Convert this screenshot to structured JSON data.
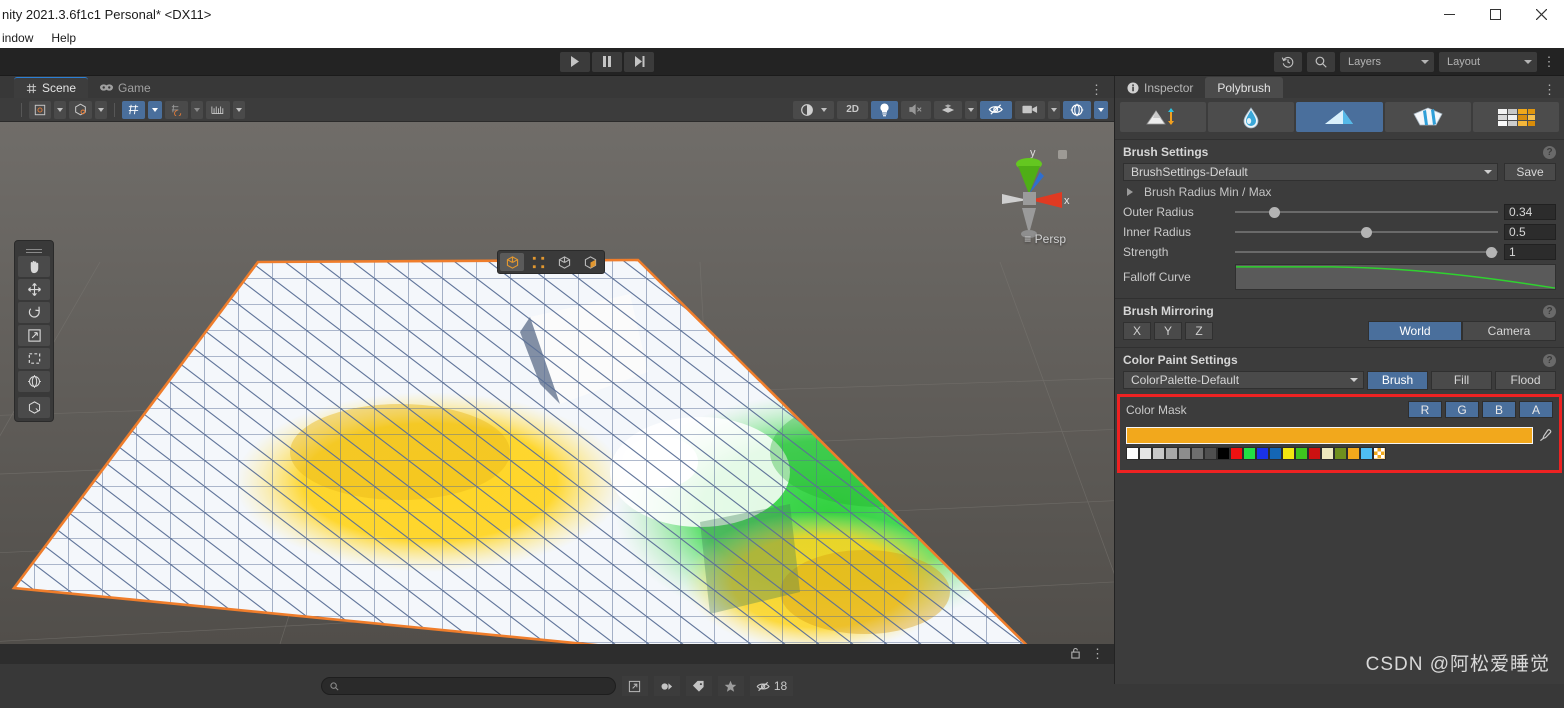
{
  "window": {
    "title": "nity 2021.3.6f1c1 Personal* <DX11>",
    "menu": [
      "indow",
      "Help"
    ],
    "controls": {
      "minimize": "—",
      "maximize": "▢",
      "close": "✕"
    }
  },
  "toolbar": {
    "play": "play-icon",
    "pause": "pause-icon",
    "step": "step-icon",
    "history_icon": "undo-history-icon",
    "search_icon": "search-icon",
    "layers": "Layers",
    "layout": "Layout"
  },
  "scene_panel": {
    "tabs": [
      {
        "label": "Scene",
        "icon": "grid-icon",
        "active": true
      },
      {
        "label": "Game",
        "icon": "gamepad-icon",
        "active": false
      }
    ],
    "overflow_menu": "⋮",
    "toolbar": {
      "pivot_mode": "pivot-icon",
      "orientation_mode": "global-local-icon",
      "grid_snap": "grid-snap-icon",
      "grid_snap_active": true,
      "surface_snap": "surface-snap-icon",
      "increment_snap": "increment-snap-icon",
      "shading_mode": "shading-mode-icon",
      "two_d": "2D",
      "lighting": "lighting-icon",
      "audio": "audio-mute-icon",
      "effects": "effects-icon",
      "hidden_objects": "hidden-objects-icon",
      "camera": "camera-icon",
      "gizmos": "gizmos-icon"
    },
    "tools_overlay": [
      "hand-tool-icon",
      "move-tool-icon",
      "rotate-tool-icon",
      "scale-tool-icon",
      "rect-tool-icon",
      "transform-tool-icon",
      "custom-editor-tool-icon"
    ],
    "element_modes": [
      {
        "name": "object-mode-icon",
        "active": true
      },
      {
        "name": "vertex-mode-icon",
        "active": false
      },
      {
        "name": "edge-mode-icon",
        "active": false
      },
      {
        "name": "face-mode-icon",
        "active": false
      }
    ],
    "gizmo": {
      "axis_x": "x",
      "axis_y": "y",
      "projection": "Persp",
      "persp_prefix": "≡"
    },
    "footer": {
      "lock_icon": "lock-icon",
      "menu_icon": "kebab-menu-icon"
    },
    "search": {
      "placeholder": "",
      "value": "",
      "icon": "search-icon",
      "popout_icon": "popout-icon",
      "filter_icons": [
        "object-filter-icon",
        "tag-filter-icon",
        "favorite-filter-icon"
      ],
      "hidden_icon": "hidden-eye-icon",
      "hidden_count": "18"
    }
  },
  "inspector": {
    "tabs": [
      {
        "label": "Inspector",
        "icon": "info-icon",
        "active": false
      },
      {
        "label": "Polybrush",
        "icon": "",
        "active": true
      }
    ],
    "overflow_menu": "⋮",
    "modes": [
      {
        "name": "sculpt-mode-icon",
        "active": false
      },
      {
        "name": "smooth-mode-icon",
        "active": false
      },
      {
        "name": "color-paint-mode-icon",
        "active": true
      },
      {
        "name": "prefab-scatter-mode-icon",
        "active": false
      },
      {
        "name": "texture-blend-mode-icon",
        "active": false
      }
    ],
    "brush_settings": {
      "title": "Brush Settings",
      "help_icon": "?",
      "preset": "BrushSettings-Default",
      "save_label": "Save",
      "radius_fold_label": "Brush Radius Min / Max",
      "fields": [
        {
          "label": "Outer Radius",
          "value": "0.34",
          "fraction": 0.14
        },
        {
          "label": "Inner Radius",
          "value": "0.5",
          "fraction": 0.5
        },
        {
          "label": "Strength",
          "value": "1",
          "fraction": 0.99
        }
      ],
      "falloff_label": "Falloff Curve",
      "falloff_color": "#2fd22f"
    },
    "brush_mirroring": {
      "title": "Brush Mirroring",
      "help_icon": "?",
      "axes": [
        "X",
        "Y",
        "Z"
      ],
      "space_options": [
        {
          "label": "World",
          "active": true
        },
        {
          "label": "Camera",
          "active": false
        }
      ]
    },
    "color_paint": {
      "title": "Color Paint Settings",
      "help_icon": "?",
      "palette": "ColorPalette-Default",
      "apply_modes": [
        {
          "label": "Brush",
          "active": true
        },
        {
          "label": "Fill",
          "active": false
        },
        {
          "label": "Flood",
          "active": false
        }
      ],
      "color_mask_label": "Color Mask",
      "channels": [
        {
          "label": "R",
          "active": true
        },
        {
          "label": "G",
          "active": true
        },
        {
          "label": "B",
          "active": true
        },
        {
          "label": "A",
          "active": true
        }
      ],
      "current_color": "#f2a81c",
      "eyedropper_icon": "eyedropper-icon",
      "swatches": [
        "#ffffff",
        "#e4e4e4",
        "#c7c7c7",
        "#a8a8a8",
        "#8d8d8d",
        "#6f6f6f",
        "#4f4f4f",
        "#000000",
        "#ee1111",
        "#22e043",
        "#1a32e8",
        "#1466b4",
        "#f2e610",
        "#3fc51e",
        "#cc1111",
        "#ece8bd",
        "#6f8f1e",
        "#f2a81c",
        "#4fbdf2",
        "checker"
      ],
      "highlight_color": "#ee2222"
    }
  },
  "watermark": "CSDN @阿松爱睡觉"
}
